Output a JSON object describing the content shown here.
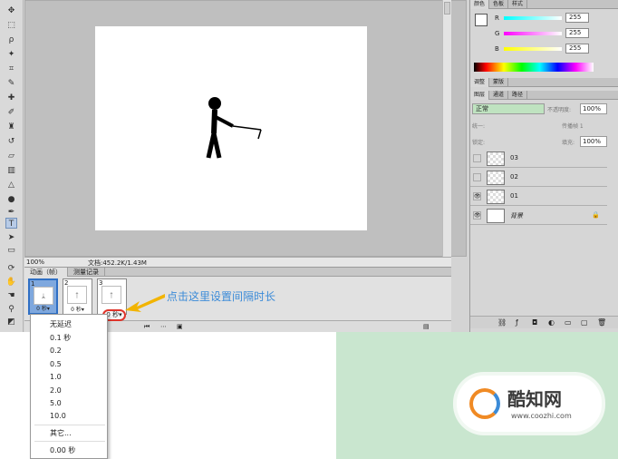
{
  "toolbar": {
    "tools": [
      "move-icon",
      "marquee-icon",
      "lasso-icon",
      "magic-wand-icon",
      "crop-icon",
      "eyedropper-icon",
      "healing-icon",
      "brush-icon",
      "stamp-icon",
      "history-brush-icon",
      "eraser-icon",
      "gradient-icon",
      "blur-icon",
      "dodge-icon",
      "pen-icon",
      "type-icon",
      "path-select-icon",
      "shape-icon",
      "hand-icon",
      "rotate-icon",
      "zoom-icon"
    ],
    "active_tool_label": "T"
  },
  "status": {
    "zoom": "100%",
    "doc_info": "文档:452.2K/1.43M"
  },
  "animation": {
    "tabs": [
      "动画（帧）",
      "测量记录"
    ],
    "frames": [
      {
        "num": "1",
        "delay": "0 秒▾"
      },
      {
        "num": "2",
        "delay": "0 秒▾"
      },
      {
        "num": "3",
        "delay": "0 秒▾"
      }
    ],
    "annotation": "点击这里设置间隔时长"
  },
  "dropdown": {
    "items": [
      "无延迟",
      "0.1 秒",
      "0.2",
      "0.5",
      "1.0",
      "2.0",
      "5.0",
      "10.0"
    ],
    "other": "其它...",
    "current": "0.00 秒"
  },
  "color_panel": {
    "tabs": [
      "颜色",
      "色板",
      "样式"
    ],
    "r_label": "R",
    "g_label": "G",
    "b_label": "B",
    "r": "255",
    "g": "255",
    "b": "255"
  },
  "adjust_panel": {
    "tabs": [
      "调整",
      "蒙版"
    ]
  },
  "layers_panel": {
    "tabs": [
      "图层",
      "通道",
      "路径"
    ],
    "blend_mode": "正常",
    "opacity_label": "不透明度:",
    "opacity": "100%",
    "unify_label": "统一:",
    "propagate_label": "传播帧 1",
    "lock_label": "锁定:",
    "fill_label": "填充:",
    "fill": "100%",
    "layers": [
      {
        "name": "03",
        "visible": false
      },
      {
        "name": "02",
        "visible": false
      },
      {
        "name": "01",
        "visible": true
      },
      {
        "name": "背景",
        "visible": true,
        "locked": true
      }
    ]
  },
  "logo": {
    "brand": "酷知网",
    "url": "www.coozhi.com"
  },
  "colors": {
    "accent_blue": "#3b8bd8",
    "highlight_red": "#e0342a",
    "green_bg": "#c9e6cf"
  }
}
